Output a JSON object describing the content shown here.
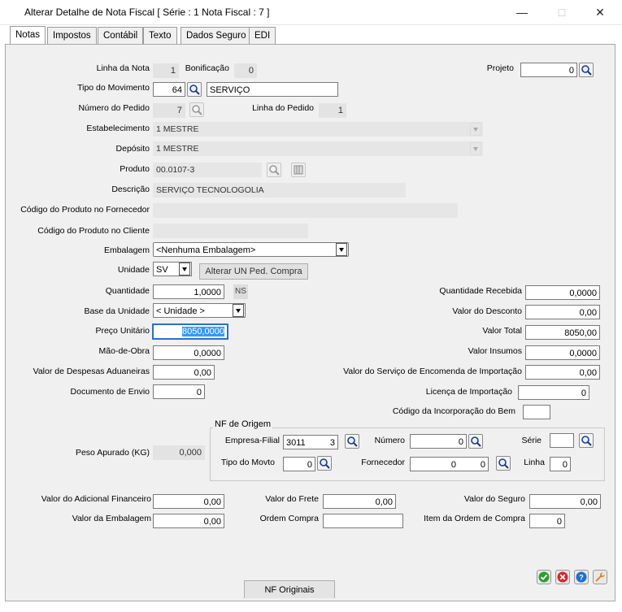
{
  "window": {
    "title": "Alterar Detalhe de Nota Fiscal [ Série : 1 Nota Fiscal : 7 ]",
    "minimize": "—",
    "maximize": "□",
    "close": "✕"
  },
  "tabs": [
    "Notas",
    "Impostos",
    "Contábil",
    "Texto",
    "Dados Seguro",
    "EDI"
  ],
  "fields": {
    "linha_nota": {
      "label": "Linha da Nota",
      "value": "1"
    },
    "bonificacao": {
      "label": "Bonificação",
      "value": "0"
    },
    "projeto": {
      "label": "Projeto",
      "value": "0"
    },
    "tipo_movimento": {
      "label": "Tipo do Movimento",
      "code": "64",
      "desc": "SERVIÇO"
    },
    "numero_pedido": {
      "label": "Número do Pedido",
      "value": "7"
    },
    "linha_pedido": {
      "label": "Linha do Pedido",
      "value": "1"
    },
    "estabelecimento": {
      "label": "Estabelecimento",
      "value": "1 MESTRE"
    },
    "deposito": {
      "label": "Depósito",
      "value": "1 MESTRE"
    },
    "produto": {
      "label": "Produto",
      "value": "00.0107-3"
    },
    "descricao": {
      "label": "Descrição",
      "value": "SERVIÇO TECNOLOGOLIA"
    },
    "cod_fornecedor": {
      "label": "Código do Produto no Fornecedor",
      "value": ""
    },
    "cod_cliente": {
      "label": "Código do Produto no Cliente",
      "value": ""
    },
    "embalagem": {
      "label": "Embalagem",
      "value": "<Nenhuma Embalagem>"
    },
    "unidade": {
      "label": "Unidade",
      "value": "SV"
    },
    "alterar_un_button": "Alterar UN Ped. Compra",
    "quantidade": {
      "label": "Quantidade",
      "value": "1,0000",
      "ns": "NS"
    },
    "base_unidade": {
      "label": "Base da Unidade",
      "value": "< Unidade >"
    },
    "preco_unitario": {
      "label": "Preço Unitário",
      "value": "8050,0000"
    },
    "mao_obra": {
      "label": "Mão-de-Obra",
      "value": "0,0000"
    },
    "despesas_aduaneiras": {
      "label": "Valor de Despesas Aduaneiras",
      "value": "0,00"
    },
    "documento_envio": {
      "label": "Documento de Envio",
      "value": "0"
    },
    "quantidade_recebida": {
      "label": "Quantidade Recebida",
      "value": "0,0000"
    },
    "valor_desconto": {
      "label": "Valor do Desconto",
      "value": "0,00"
    },
    "valor_total": {
      "label": "Valor Total",
      "value": "8050,00"
    },
    "valor_insumos": {
      "label": "Valor Insumos",
      "value": "0,0000"
    },
    "servico_encomenda": {
      "label": "Valor do Serviço de Encomenda de Importação",
      "value": "0,00"
    },
    "licenca_importacao": {
      "label": "Licença de Importação",
      "value": "0"
    },
    "cod_incorporacao": {
      "label": "Código da Incorporação do Bem",
      "value": ""
    },
    "peso_apurado": {
      "label": "Peso Apurado (KG)",
      "value": "0,000"
    },
    "adicional_financeiro": {
      "label": "Valor do Adicional Financeiro",
      "value": "0,00"
    },
    "valor_frete": {
      "label": "Valor do Frete",
      "value": "0,00"
    },
    "valor_seguro": {
      "label": "Valor do Seguro",
      "value": "0,00"
    },
    "valor_embalagem": {
      "label": "Valor da Embalagem",
      "value": "0,00"
    },
    "ordem_compra": {
      "label": "Ordem Compra",
      "value": ""
    },
    "item_ordem_compra": {
      "label": "Item da Ordem de Compra",
      "value": "0"
    }
  },
  "nf_origem": {
    "legend": "NF de Origem",
    "empresa_filial": {
      "label": "Empresa-Filial",
      "empresa": "3011",
      "filial": "3"
    },
    "numero": {
      "label": "Número",
      "value": "0"
    },
    "serie": {
      "label": "Série",
      "value": ""
    },
    "tipo_movto": {
      "label": "Tipo do Movto",
      "value": "0"
    },
    "fornecedor": {
      "label": "Fornecedor",
      "value1": "0",
      "value2": "0"
    },
    "linha": {
      "label": "Linha",
      "value": "0"
    }
  },
  "footer": {
    "nf_originais": "NF Originais"
  },
  "colors": {
    "ok": "#2e9e2e",
    "cancel": "#d9262c",
    "help": "#1f6fd1",
    "tool": "#e3861c"
  }
}
